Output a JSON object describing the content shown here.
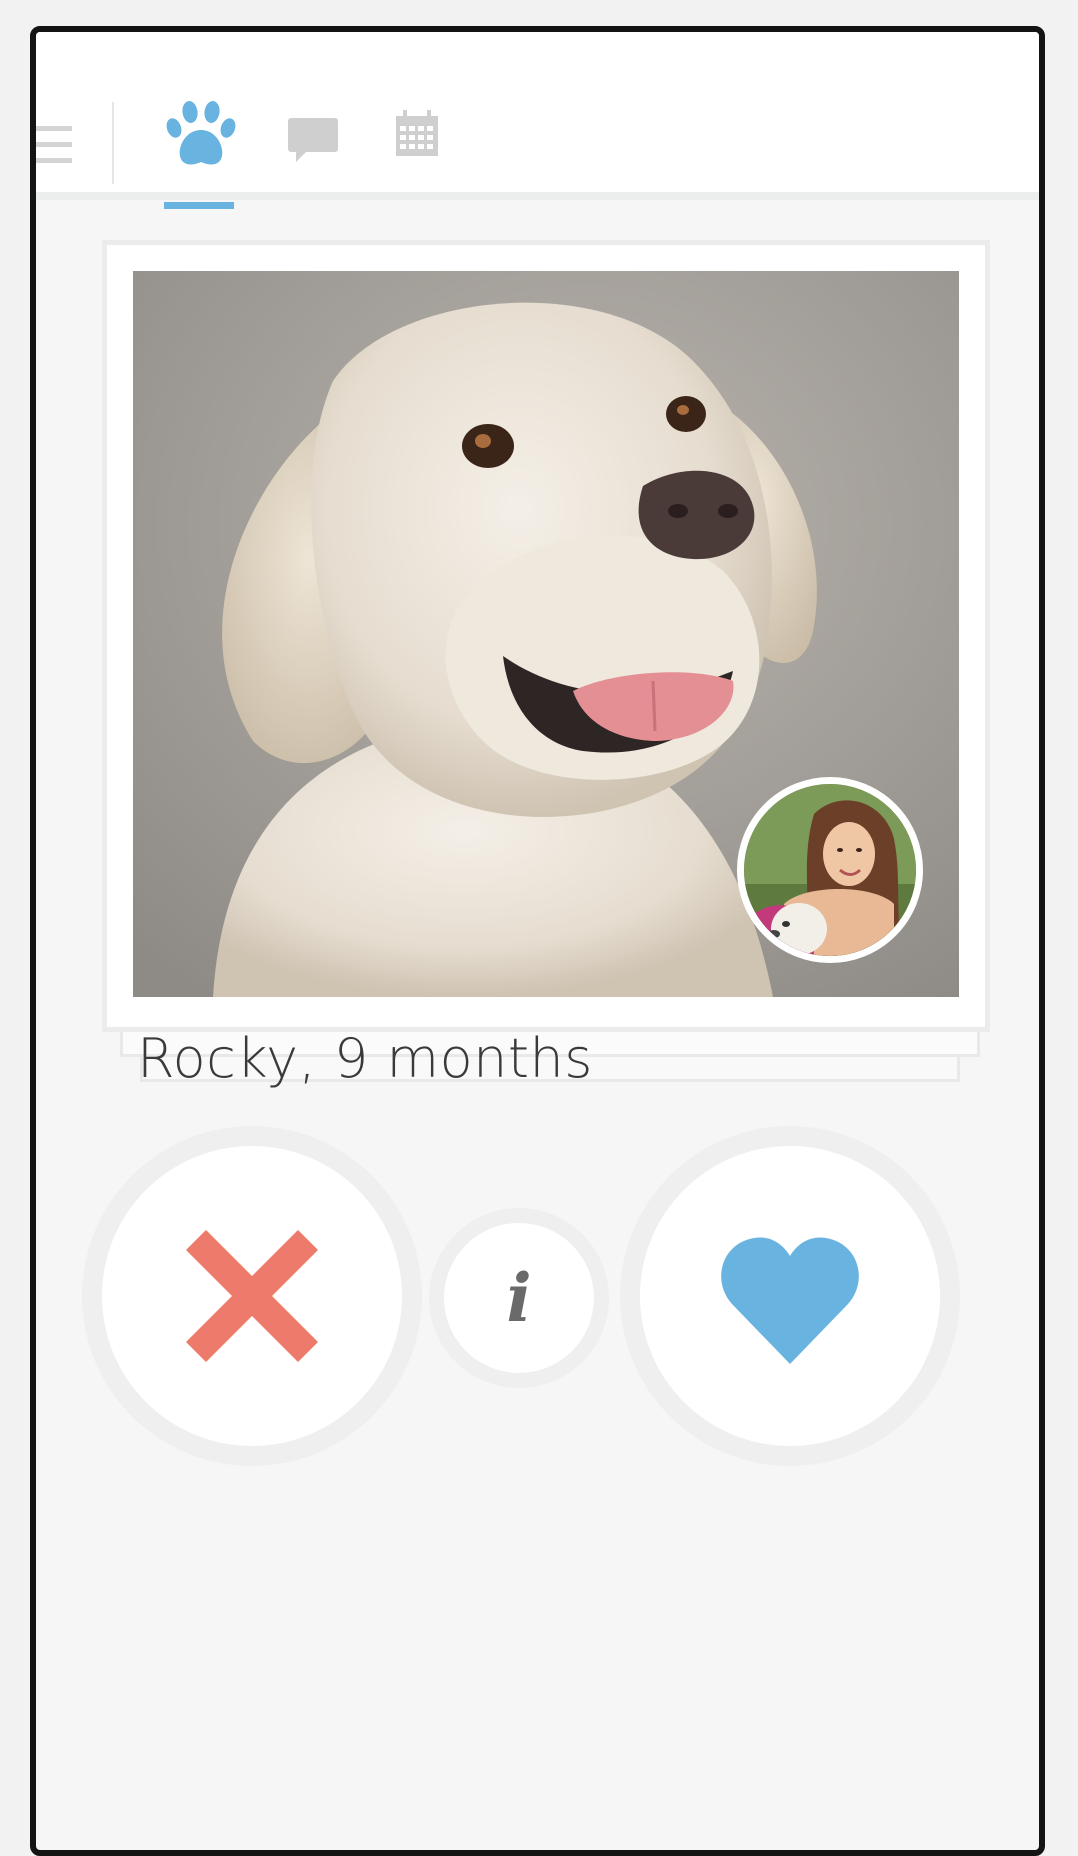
{
  "tabs": [
    {
      "name": "menu",
      "icon": "menu-icon"
    },
    {
      "name": "discover",
      "icon": "paw-icon",
      "active": true
    },
    {
      "name": "chat",
      "icon": "chat-bubble-icon"
    },
    {
      "name": "events",
      "icon": "calendar-icon"
    }
  ],
  "card": {
    "caption": "Rocky, 9 months",
    "photo": "dog-photo",
    "owner_photo": "owner-avatar"
  },
  "actions": {
    "dislike_icon": "x-icon",
    "info_label": "i",
    "like_icon": "heart-icon"
  },
  "colors": {
    "accent_blue": "#69b3e1",
    "dislike_red": "#ee7a6b",
    "tab_inactive": "#cfcfcf",
    "info_grey": "#6a6a6a"
  }
}
